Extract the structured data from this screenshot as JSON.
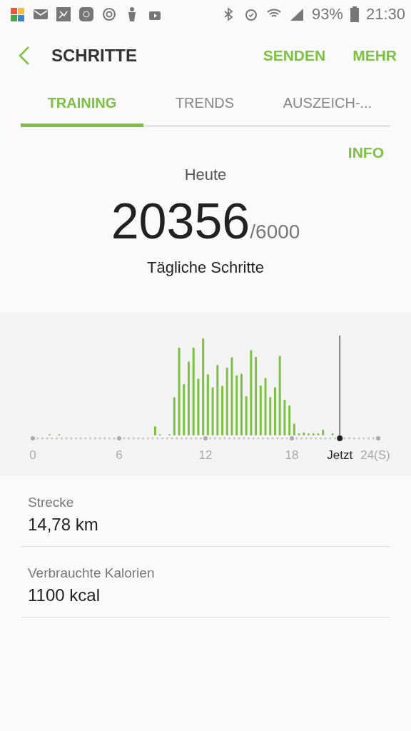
{
  "status_bar": {
    "battery": "93%",
    "time": "21:30"
  },
  "header": {
    "title": "SCHRITTE",
    "actions": [
      "SENDEN",
      "MEHR"
    ]
  },
  "tabs": [
    {
      "label": "TRAINING",
      "selected": true
    },
    {
      "label": "TRENDS",
      "selected": false
    },
    {
      "label": "AUSZEICH-...",
      "selected": false
    }
  ],
  "info_link": "INFO",
  "summary": {
    "period": "Heute",
    "steps": "20356",
    "goal": "/6000",
    "caption": "Tägliche Schritte"
  },
  "chart": {
    "axis_labels": [
      "0",
      "6",
      "12",
      "18"
    ],
    "now_label": "Jetzt",
    "end_label": "24(S)"
  },
  "stats": [
    {
      "label": "Strecke",
      "value": "14,78 km"
    },
    {
      "label": "Verbrauchte Kalorien",
      "value": "1100 kcal"
    }
  ]
}
